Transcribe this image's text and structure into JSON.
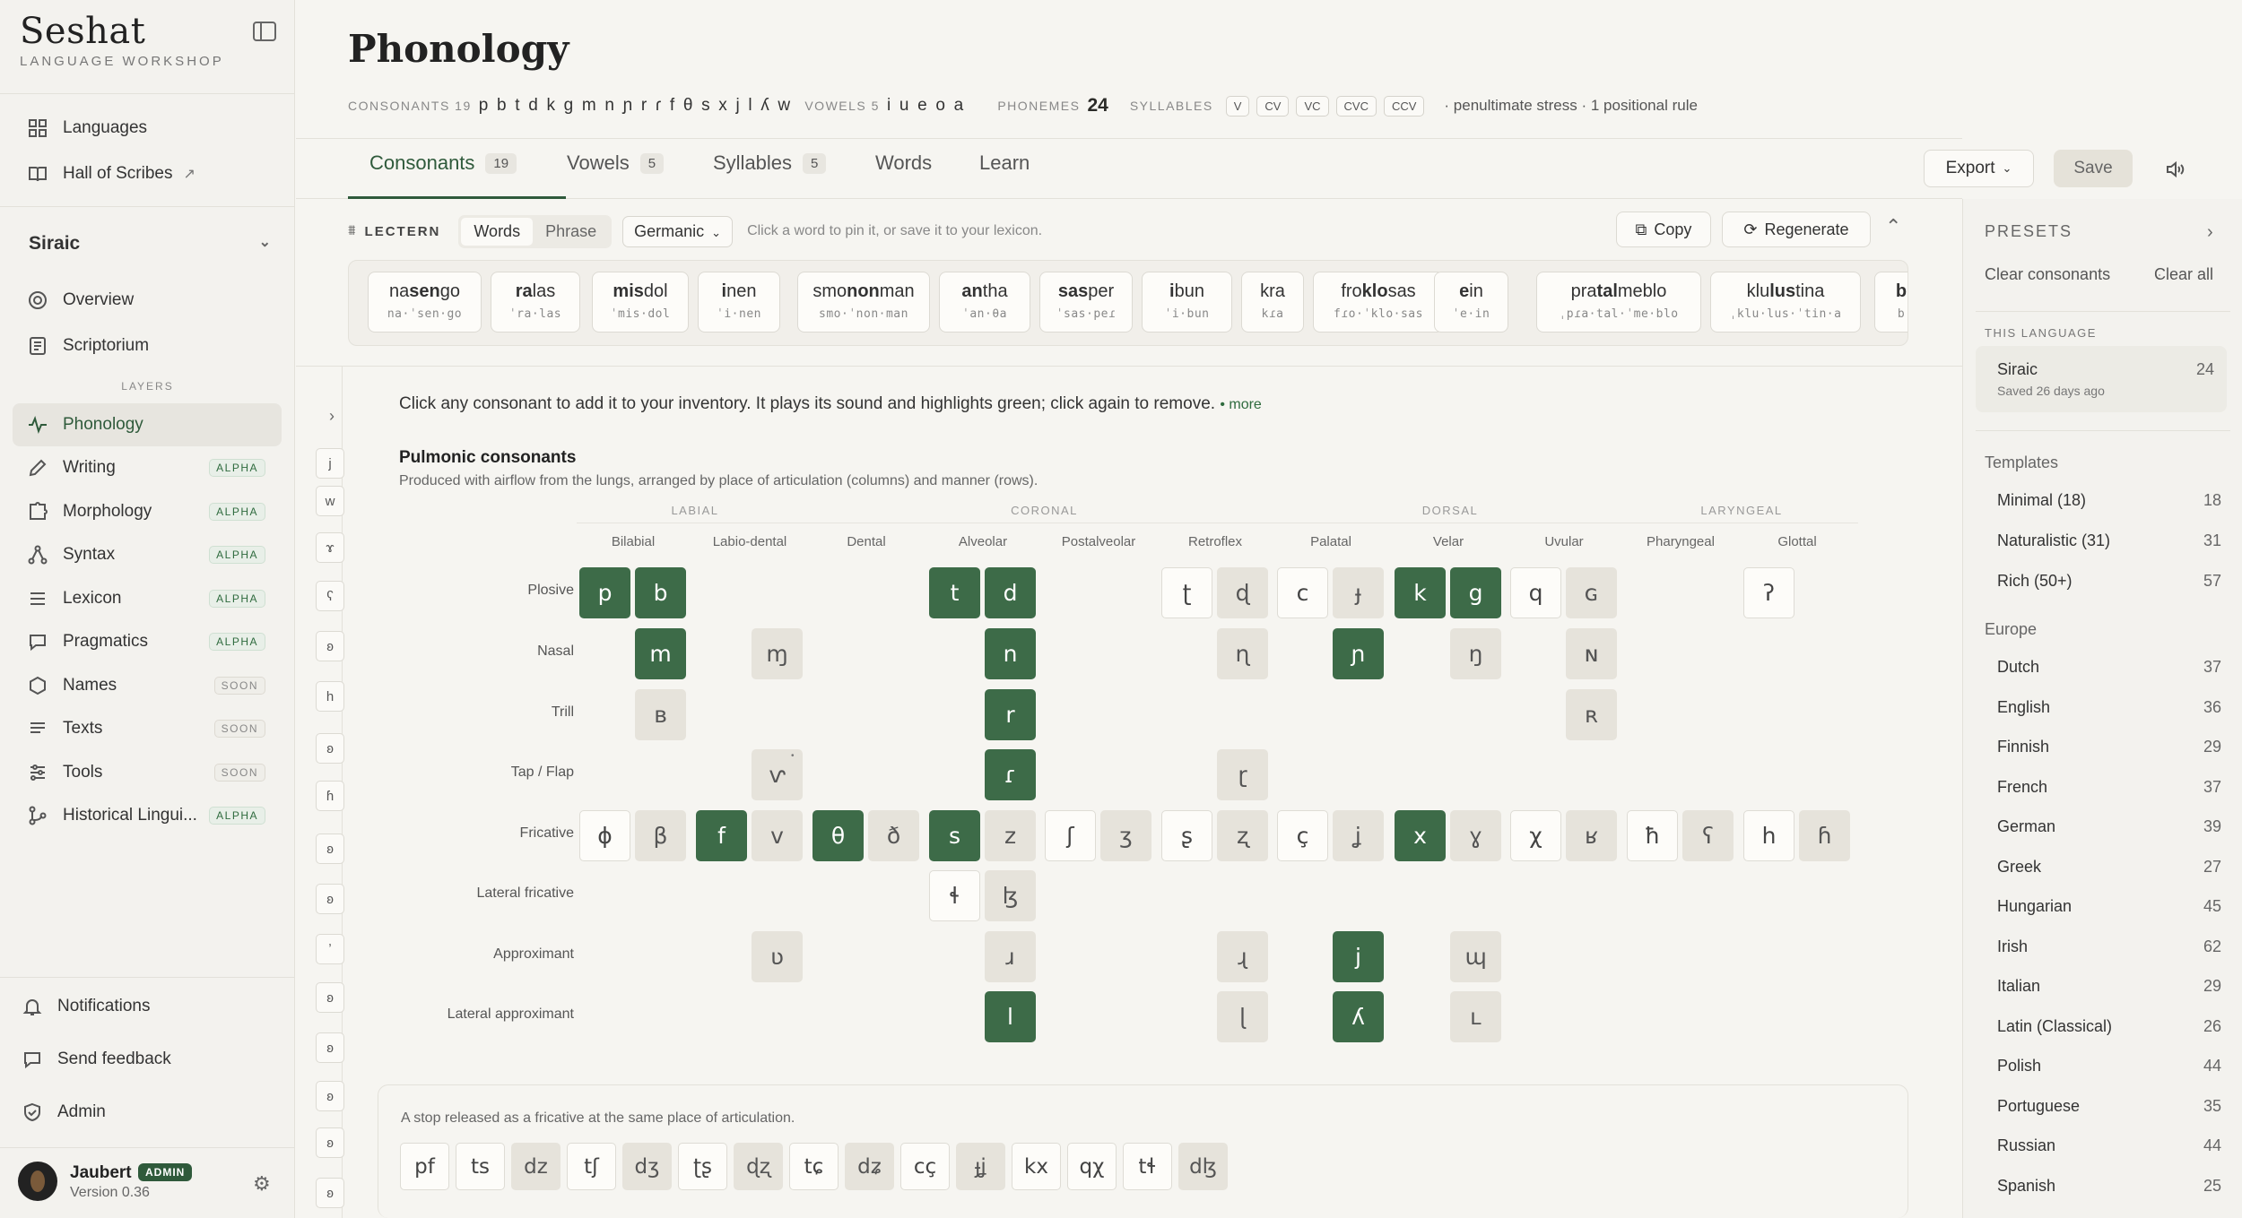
{
  "brand": {
    "name": "Seshat",
    "subtitle": "LANGUAGE WORKSHOP"
  },
  "nav_top": [
    {
      "label": "Languages",
      "icon": "grid-icon"
    },
    {
      "label": "Hall of Scribes",
      "icon": "book-icon"
    }
  ],
  "language": {
    "name": "Siraic"
  },
  "nav_lang": [
    {
      "label": "Overview"
    },
    {
      "label": "Scriptorium"
    }
  ],
  "layers_label": "LAYERS",
  "layers": [
    {
      "label": "Phonology",
      "badge": ""
    },
    {
      "label": "Writing",
      "badge": "ALPHA"
    },
    {
      "label": "Morphology",
      "badge": "ALPHA"
    },
    {
      "label": "Syntax",
      "badge": "ALPHA"
    },
    {
      "label": "Lexicon",
      "badge": "ALPHA"
    },
    {
      "label": "Pragmatics",
      "badge": "ALPHA"
    },
    {
      "label": "Names",
      "badge": "SOON"
    },
    {
      "label": "Texts",
      "badge": "SOON"
    },
    {
      "label": "Tools",
      "badge": "SOON"
    },
    {
      "label": "Historical Lingui...",
      "badge": "ALPHA"
    }
  ],
  "bottom_nav": [
    {
      "label": "Notifications"
    },
    {
      "label": "Send feedback"
    },
    {
      "label": "Admin"
    }
  ],
  "user": {
    "name": "Jaubert",
    "role": "ADMIN",
    "version": "Version 0.36"
  },
  "page": {
    "title": "Phonology"
  },
  "summary": {
    "consonants_label": "CONSONANTS 19",
    "consonants": "p b t d k g m n ɲ r ɾ f θ s x j l ʎ w",
    "vowels_label": "VOWELS 5",
    "vowels": "i u e o a",
    "phonemes_label": "PHONEMES",
    "phonemes": "24",
    "syllables_label": "SYLLABLES",
    "syllables": [
      "V",
      "CV",
      "VC",
      "CVC",
      "CCV"
    ],
    "note": "· penultimate stress · 1 positional rule"
  },
  "tabs": [
    {
      "label": "Consonants",
      "count": "19"
    },
    {
      "label": "Vowels",
      "count": "5"
    },
    {
      "label": "Syllables",
      "count": "5"
    },
    {
      "label": "Words",
      "count": ""
    },
    {
      "label": "Learn",
      "count": ""
    }
  ],
  "actions": {
    "export": "Export",
    "save": "Save"
  },
  "lectern": {
    "title": "LECTERN",
    "words": "Words",
    "phrase": "Phrase",
    "style": "Germanic",
    "hint": "Click a word to pin it, or save it to your lexicon.",
    "copy": "Copy",
    "regenerate": "Regenerate",
    "cards": [
      {
        "pre": "na",
        "b": "sen",
        "post": "go",
        "ipa": "na·ˈsen·go"
      },
      {
        "pre": "",
        "b": "ra",
        "post": "las",
        "ipa": "ˈra·las"
      },
      {
        "pre": "",
        "b": "mis",
        "post": "dol",
        "ipa": "ˈmis·dol"
      },
      {
        "pre": "",
        "b": "i",
        "post": "nen",
        "ipa": "ˈi·nen"
      },
      {
        "pre": "smo",
        "b": "non",
        "post": "man",
        "ipa": "smo·ˈnon·man"
      },
      {
        "pre": "",
        "b": "an",
        "post": "tha",
        "ipa": "ˈan·θa"
      },
      {
        "pre": "",
        "b": "sas",
        "post": "per",
        "ipa": "ˈsas·peɾ"
      },
      {
        "pre": "",
        "b": "i",
        "post": "bun",
        "ipa": "ˈi·bun"
      },
      {
        "pre": "",
        "b": "",
        "post": "kra",
        "ipa": "kɾa"
      },
      {
        "pre": "fro",
        "b": "klo",
        "post": "sas",
        "ipa": "fɾo·ˈklo·sas"
      },
      {
        "pre": "",
        "b": "e",
        "post": "in",
        "ipa": "ˈe·in"
      },
      {
        "pre": "pra",
        "b": "tal",
        "post": "meblo",
        "ipa": "ˌpɾa·tal·ˈme·blo"
      },
      {
        "pre": "klu",
        "b": "lus",
        "post": "tina",
        "ipa": "ˌklu·lus·ˈtin·a"
      },
      {
        "pre": "",
        "b": "b",
        "post": "",
        "ipa": "b"
      }
    ]
  },
  "strip": [
    "j",
    "w",
    "ɤ",
    "ʕ",
    "ʚ",
    "h",
    "ʚ",
    "ɦ",
    "ʚ",
    "ʚ",
    "ʼ",
    "ʚ",
    "ʚ",
    "ʚ",
    "ʚ",
    "ʚ"
  ],
  "intro": {
    "text": "Click any consonant to add it to your inventory. It plays its sound and highlights green; click again to remove.",
    "more": "• more"
  },
  "pulmonic": {
    "title": "Pulmonic consonants",
    "subtitle": "Produced with airflow from the lungs, arranged by place of articulation (columns) and manner (rows).",
    "groups": [
      "LABIAL",
      "CORONAL",
      "DORSAL",
      "LARYNGEAL"
    ],
    "places": [
      "Bilabial",
      "Labio-dental",
      "Dental",
      "Alveolar",
      "Postalveolar",
      "Retroflex",
      "Palatal",
      "Velar",
      "Uvular",
      "Pharyngeal",
      "Glottal"
    ],
    "manners": [
      "Plosive",
      "Nasal",
      "Trill",
      "Tap / Flap",
      "Fricative",
      "Lateral fricative",
      "Approximant",
      "Lateral approximant"
    ],
    "cells": [
      {
        "s": "p",
        "r": 0,
        "c": 0,
        "v": 0,
        "st": "green"
      },
      {
        "s": "b",
        "r": 0,
        "c": 0,
        "v": 1,
        "st": "green"
      },
      {
        "s": "t",
        "r": 0,
        "c": 3,
        "v": 0,
        "st": "green"
      },
      {
        "s": "d",
        "r": 0,
        "c": 3,
        "v": 1,
        "st": "green"
      },
      {
        "s": "ʈ",
        "r": 0,
        "c": 5,
        "v": 0,
        "st": "white"
      },
      {
        "s": "ɖ",
        "r": 0,
        "c": 5,
        "v": 1,
        "st": "gray"
      },
      {
        "s": "c",
        "r": 0,
        "c": 6,
        "v": 0,
        "st": "white"
      },
      {
        "s": "ɟ",
        "r": 0,
        "c": 6,
        "v": 1,
        "st": "gray"
      },
      {
        "s": "k",
        "r": 0,
        "c": 7,
        "v": 0,
        "st": "green"
      },
      {
        "s": "g",
        "r": 0,
        "c": 7,
        "v": 1,
        "st": "green"
      },
      {
        "s": "q",
        "r": 0,
        "c": 8,
        "v": 0,
        "st": "white"
      },
      {
        "s": "ɢ",
        "r": 0,
        "c": 8,
        "v": 1,
        "st": "gray"
      },
      {
        "s": "ʔ",
        "r": 0,
        "c": 10,
        "v": 0,
        "st": "white"
      },
      {
        "s": "m",
        "r": 1,
        "c": 0,
        "v": 1,
        "st": "green"
      },
      {
        "s": "ɱ",
        "r": 1,
        "c": 1,
        "v": 1,
        "st": "gray"
      },
      {
        "s": "n",
        "r": 1,
        "c": 3,
        "v": 1,
        "st": "green"
      },
      {
        "s": "ɳ",
        "r": 1,
        "c": 5,
        "v": 1,
        "st": "gray"
      },
      {
        "s": "ɲ",
        "r": 1,
        "c": 6,
        "v": 1,
        "st": "green"
      },
      {
        "s": "ŋ",
        "r": 1,
        "c": 7,
        "v": 1,
        "st": "gray"
      },
      {
        "s": "ɴ",
        "r": 1,
        "c": 8,
        "v": 1,
        "st": "gray"
      },
      {
        "s": "ʙ",
        "r": 2,
        "c": 0,
        "v": 1,
        "st": "gray"
      },
      {
        "s": "r",
        "r": 2,
        "c": 3,
        "v": 1,
        "st": "green"
      },
      {
        "s": "ʀ",
        "r": 2,
        "c": 8,
        "v": 1,
        "st": "gray"
      },
      {
        "s": "ⱱ",
        "r": 3,
        "c": 1,
        "v": 1,
        "st": "gray"
      },
      {
        "s": "ɾ",
        "r": 3,
        "c": 3,
        "v": 1,
        "st": "green"
      },
      {
        "s": "ɽ",
        "r": 3,
        "c": 5,
        "v": 1,
        "st": "gray"
      },
      {
        "s": "ɸ",
        "r": 4,
        "c": 0,
        "v": 0,
        "st": "white"
      },
      {
        "s": "β",
        "r": 4,
        "c": 0,
        "v": 1,
        "st": "gray"
      },
      {
        "s": "f",
        "r": 4,
        "c": 1,
        "v": 0,
        "st": "green"
      },
      {
        "s": "v",
        "r": 4,
        "c": 1,
        "v": 1,
        "st": "gray"
      },
      {
        "s": "θ",
        "r": 4,
        "c": 2,
        "v": 0,
        "st": "green"
      },
      {
        "s": "ð",
        "r": 4,
        "c": 2,
        "v": 1,
        "st": "gray"
      },
      {
        "s": "s",
        "r": 4,
        "c": 3,
        "v": 0,
        "st": "green"
      },
      {
        "s": "z",
        "r": 4,
        "c": 3,
        "v": 1,
        "st": "gray"
      },
      {
        "s": "ʃ",
        "r": 4,
        "c": 4,
        "v": 0,
        "st": "white"
      },
      {
        "s": "ʒ",
        "r": 4,
        "c": 4,
        "v": 1,
        "st": "gray"
      },
      {
        "s": "ʂ",
        "r": 4,
        "c": 5,
        "v": 0,
        "st": "white"
      },
      {
        "s": "ʐ",
        "r": 4,
        "c": 5,
        "v": 1,
        "st": "gray"
      },
      {
        "s": "ç",
        "r": 4,
        "c": 6,
        "v": 0,
        "st": "white"
      },
      {
        "s": "ʝ",
        "r": 4,
        "c": 6,
        "v": 1,
        "st": "gray"
      },
      {
        "s": "x",
        "r": 4,
        "c": 7,
        "v": 0,
        "st": "green"
      },
      {
        "s": "ɣ",
        "r": 4,
        "c": 7,
        "v": 1,
        "st": "gray"
      },
      {
        "s": "χ",
        "r": 4,
        "c": 8,
        "v": 0,
        "st": "white"
      },
      {
        "s": "ʁ",
        "r": 4,
        "c": 8,
        "v": 1,
        "st": "gray"
      },
      {
        "s": "ħ",
        "r": 4,
        "c": 9,
        "v": 0,
        "st": "white"
      },
      {
        "s": "ʕ",
        "r": 4,
        "c": 9,
        "v": 1,
        "st": "gray"
      },
      {
        "s": "h",
        "r": 4,
        "c": 10,
        "v": 0,
        "st": "white"
      },
      {
        "s": "ɦ",
        "r": 4,
        "c": 10,
        "v": 1,
        "st": "gray"
      },
      {
        "s": "ɬ",
        "r": 5,
        "c": 3,
        "v": 0,
        "st": "white"
      },
      {
        "s": "ɮ",
        "r": 5,
        "c": 3,
        "v": 1,
        "st": "gray"
      },
      {
        "s": "ʋ",
        "r": 6,
        "c": 1,
        "v": 1,
        "st": "gray"
      },
      {
        "s": "ɹ",
        "r": 6,
        "c": 3,
        "v": 1,
        "st": "gray"
      },
      {
        "s": "ɻ",
        "r": 6,
        "c": 5,
        "v": 1,
        "st": "gray"
      },
      {
        "s": "j",
        "r": 6,
        "c": 6,
        "v": 1,
        "st": "green"
      },
      {
        "s": "ɰ",
        "r": 6,
        "c": 7,
        "v": 1,
        "st": "gray"
      },
      {
        "s": "l",
        "r": 7,
        "c": 3,
        "v": 1,
        "st": "green"
      },
      {
        "s": "ɭ",
        "r": 7,
        "c": 5,
        "v": 1,
        "st": "gray"
      },
      {
        "s": "ʎ",
        "r": 7,
        "c": 6,
        "v": 1,
        "st": "green"
      },
      {
        "s": "ʟ",
        "r": 7,
        "c": 7,
        "v": 1,
        "st": "gray"
      }
    ]
  },
  "affricates": {
    "desc": "A stop released as a fricative at the same place of articulation.",
    "items": [
      {
        "s": "pf",
        "st": "white"
      },
      {
        "s": "ts",
        "st": "white"
      },
      {
        "s": "dz",
        "st": "gray"
      },
      {
        "s": "tʃ",
        "st": "white"
      },
      {
        "s": "dʒ",
        "st": "gray"
      },
      {
        "s": "ʈʂ",
        "st": "white"
      },
      {
        "s": "ɖʐ",
        "st": "gray"
      },
      {
        "s": "tɕ",
        "st": "white"
      },
      {
        "s": "dʑ",
        "st": "gray"
      },
      {
        "s": "cç",
        "st": "white"
      },
      {
        "s": "ɟʝ",
        "st": "gray"
      },
      {
        "s": "kx",
        "st": "white"
      },
      {
        "s": "qχ",
        "st": "white"
      },
      {
        "s": "tɬ",
        "st": "white"
      },
      {
        "s": "dɮ",
        "st": "gray"
      }
    ]
  },
  "presets": {
    "title": "PRESETS",
    "clear_consonants": "Clear consonants",
    "clear_all": "Clear all",
    "this_language_label": "THIS LANGUAGE",
    "this_language": {
      "name": "Siraic",
      "meta": "Saved 26 days ago",
      "count": "24"
    },
    "templates_label": "Templates",
    "templates": [
      {
        "name": "Minimal (18)",
        "count": "18"
      },
      {
        "name": "Naturalistic (31)",
        "count": "31"
      },
      {
        "name": "Rich (50+)",
        "count": "57"
      }
    ],
    "europe_label": "Europe",
    "europe": [
      {
        "name": "Dutch",
        "count": "37"
      },
      {
        "name": "English",
        "count": "36"
      },
      {
        "name": "Finnish",
        "count": "29"
      },
      {
        "name": "French",
        "count": "37"
      },
      {
        "name": "German",
        "count": "39"
      },
      {
        "name": "Greek",
        "count": "27"
      },
      {
        "name": "Hungarian",
        "count": "45"
      },
      {
        "name": "Irish",
        "count": "62"
      },
      {
        "name": "Italian",
        "count": "29"
      },
      {
        "name": "Latin (Classical)",
        "count": "26"
      },
      {
        "name": "Polish",
        "count": "44"
      },
      {
        "name": "Portuguese",
        "count": "35"
      },
      {
        "name": "Russian",
        "count": "44"
      },
      {
        "name": "Spanish",
        "count": "25"
      }
    ]
  }
}
